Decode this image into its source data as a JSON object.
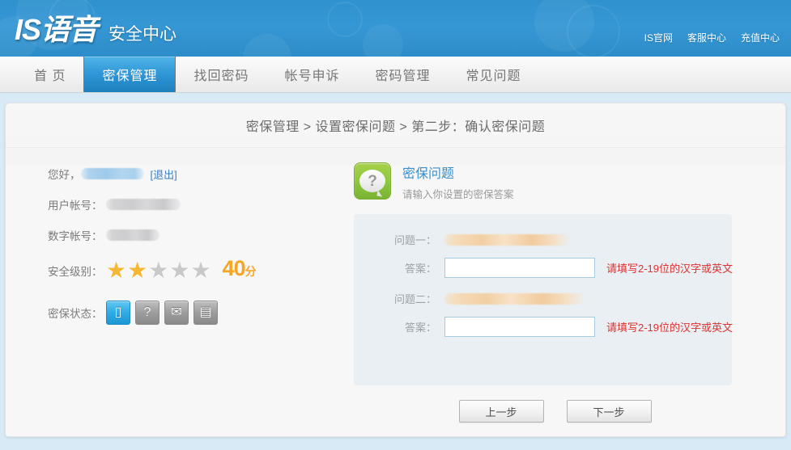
{
  "header": {
    "logo": "IS语音",
    "subtitle": "安全中心",
    "top_links": [
      {
        "label": "IS官网"
      },
      {
        "label": "客服中心"
      },
      {
        "label": "充值中心"
      }
    ],
    "brand_color": "#3597d4"
  },
  "nav": {
    "items": [
      {
        "label": "首 页",
        "active": false
      },
      {
        "label": "密保管理",
        "active": true
      },
      {
        "label": "找回密码",
        "active": false
      },
      {
        "label": "帐号申诉",
        "active": false
      },
      {
        "label": "密码管理",
        "active": false
      },
      {
        "label": "常见问题",
        "active": false
      }
    ]
  },
  "breadcrumb": {
    "text": "密保管理 > 设置密保问题 > 第二步：确认密保问题"
  },
  "account": {
    "greeting_label": "您好，",
    "logout_label": "[退出]",
    "user_account_label": "用户帐号：",
    "numeric_account_label": "数字帐号：",
    "security_level_label": "安全级别：",
    "protect_status_label": "密保状态：",
    "score": "40",
    "score_unit": "分",
    "stars_filled": 2,
    "stars_total": 5,
    "star_on_color": "#f6b833",
    "star_off_color": "#c9c9c9",
    "badges": [
      {
        "icon": "mobile-phone-icon",
        "glyph": "▯",
        "active": true
      },
      {
        "icon": "question-bubble-icon",
        "glyph": "?",
        "active": false
      },
      {
        "icon": "mail-envelope-icon",
        "glyph": "✉",
        "active": false
      },
      {
        "icon": "id-card-icon",
        "glyph": "▤",
        "active": false
      }
    ]
  },
  "panel": {
    "icon": "question-mark-icon",
    "icon_glyph": "?",
    "title": "密保问题",
    "subtitle": "请输入你设置的密保答案",
    "title_color": "#3b8fc9",
    "rows": [
      {
        "question_label": "问题一：",
        "answer_label": "答案：",
        "answer_value": "",
        "hint": "请填写2-19位的汉字或英文"
      },
      {
        "question_label": "问题二：",
        "answer_label": "答案：",
        "answer_value": "",
        "hint": "请填写2-19位的汉字或英文"
      }
    ],
    "hint_color": "#e03131"
  },
  "buttons": {
    "prev": "上一步",
    "next": "下一步"
  }
}
